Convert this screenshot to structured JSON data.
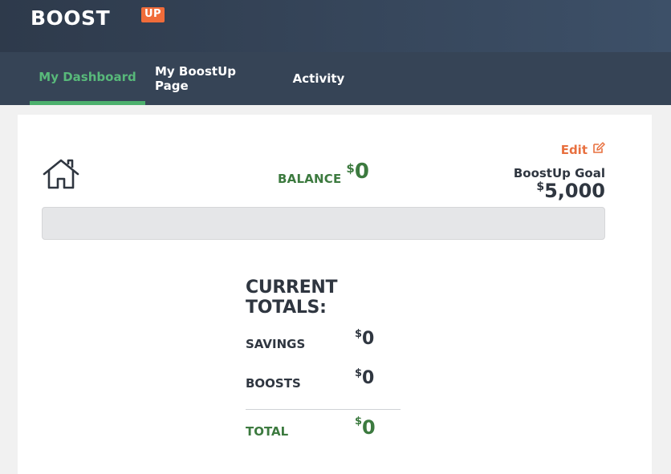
{
  "header": {
    "logo_text": "BOOST",
    "logo_badge": "UP"
  },
  "nav": {
    "tabs": [
      {
        "label": "My Dashboard",
        "active": true
      },
      {
        "label": "My BoostUp Page",
        "active": false
      },
      {
        "label": "Activity",
        "active": false
      }
    ]
  },
  "dashboard": {
    "edit_label": "Edit",
    "balance_label": "BALANCE",
    "balance_currency": "$",
    "balance_value": "0",
    "goal_label": "BoostUp Goal",
    "goal_currency": "$",
    "goal_value": "5,000",
    "progress_fraction": 0
  },
  "totals": {
    "title": "CURRENT TOTALS:",
    "rows": [
      {
        "label": "SAVINGS",
        "currency": "$",
        "value": "0"
      },
      {
        "label": "BOOSTS",
        "currency": "$",
        "value": "0"
      }
    ],
    "total": {
      "label": "TOTAL",
      "currency": "$",
      "value": "0"
    }
  },
  "colors": {
    "accent_green": "#3c7a3f",
    "tab_active_green": "#4cb06d",
    "edit_orange": "#e8703f",
    "header_dark": "#364456"
  },
  "icons": {
    "home": "home-icon",
    "edit": "edit-icon"
  }
}
